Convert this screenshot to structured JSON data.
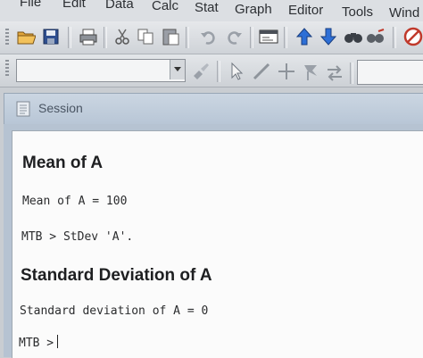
{
  "menu": [
    {
      "label": "File"
    },
    {
      "label": "Edit"
    },
    {
      "label": "Data"
    },
    {
      "label": "Calc"
    },
    {
      "label": "Stat"
    },
    {
      "label": "Graph"
    },
    {
      "label": "Editor"
    },
    {
      "label": "Tools"
    },
    {
      "label": "Wind"
    }
  ],
  "toolbar_icons": [
    "open-icon",
    "save-icon",
    "print-icon",
    "cut-icon",
    "copy-icon",
    "paste-icon",
    "undo-icon",
    "redo-icon",
    "session-window-icon",
    "arrow-up-icon",
    "arrow-down-icon",
    "find-icon",
    "replace-icon",
    "cancel-icon"
  ],
  "toolbar2_icons": [
    "brush-icon",
    "pointer-icon",
    "line-icon",
    "crosshair-icon",
    "flag-icon",
    "swap-icon"
  ],
  "combo": {
    "value": ""
  },
  "session": {
    "title": "Session",
    "heading1": "Mean of A",
    "line1": "Mean of A = 100",
    "line2": "MTB > StDev 'A'.",
    "heading2": "Standard Deviation of A",
    "line3": "Standard deviation of A = 0",
    "prompt": "MTB >"
  }
}
